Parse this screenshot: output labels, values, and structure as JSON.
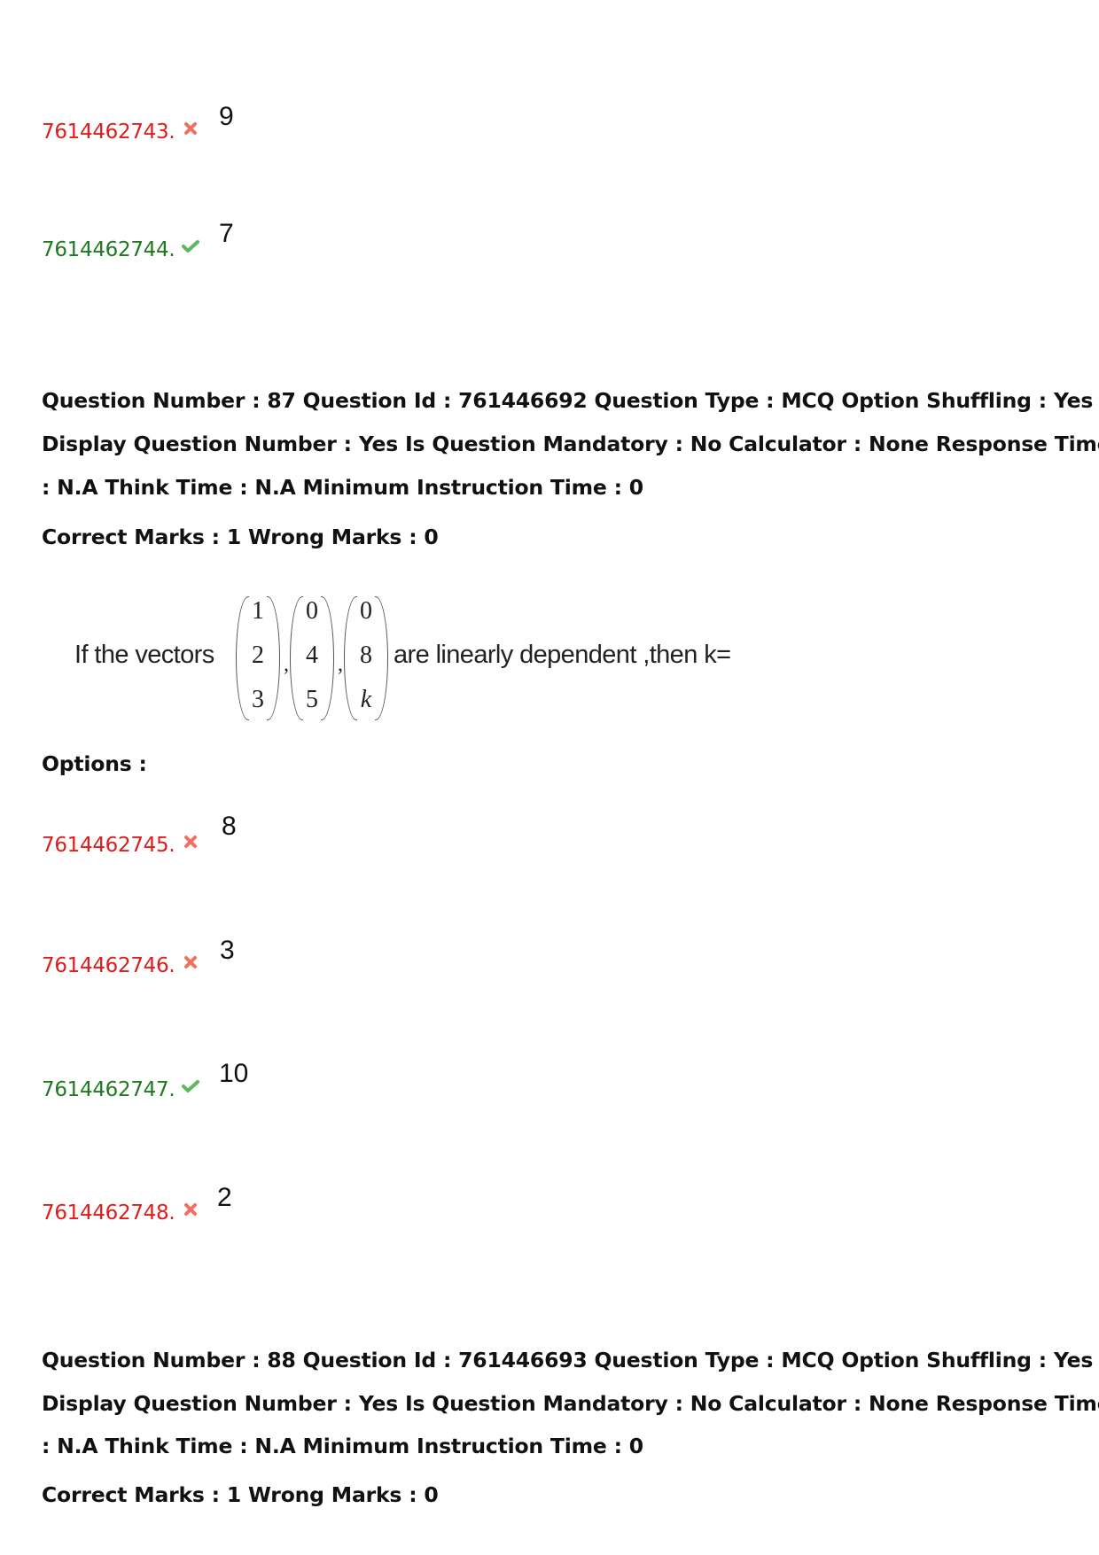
{
  "colors": {
    "wrong": "#e01b1b",
    "correct": "#1f7a1f",
    "wrong_icon": "#f07060",
    "correct_icon": "#5cb85c"
  },
  "prev_options": [
    {
      "id": "7614462743.",
      "status": "wrong",
      "icon": "cross-icon",
      "answer": "9"
    },
    {
      "id": "7614462744.",
      "status": "correct",
      "icon": "check-icon",
      "answer": "7"
    }
  ],
  "q87": {
    "header_lines": [
      "Question Number : 87 Question Id : 761446692 Question Type : MCQ Option Shuffling : Yes",
      "Display Question Number : Yes Is Question Mandatory : No Calculator : None Response Time",
      ": N.A Think Time : N.A Minimum Instruction Time : 0"
    ],
    "marks": "Correct Marks : 1 Wrong Marks : 0",
    "question": {
      "prefix": "If the vectors",
      "vectors": [
        [
          "1",
          "2",
          "3"
        ],
        [
          "0",
          "4",
          "5"
        ],
        [
          "0",
          "8",
          "k"
        ]
      ],
      "comma": ",",
      "suffix": "are linearly dependent ,then k="
    },
    "options_label": "Options :",
    "options": [
      {
        "id": "7614462745.",
        "status": "wrong",
        "icon": "cross-icon",
        "answer": "8"
      },
      {
        "id": "7614462746.",
        "status": "wrong",
        "icon": "cross-icon",
        "answer": "3"
      },
      {
        "id": "7614462747.",
        "status": "correct",
        "icon": "check-icon",
        "answer": "10"
      },
      {
        "id": "7614462748.",
        "status": "wrong",
        "icon": "cross-icon",
        "answer": "2"
      }
    ]
  },
  "q88": {
    "header_lines": [
      "Question Number : 88 Question Id : 761446693 Question Type : MCQ Option Shuffling : Yes",
      "Display Question Number : Yes Is Question Mandatory : No Calculator : None Response Time",
      ": N.A Think Time : N.A Minimum Instruction Time : 0"
    ],
    "marks": "Correct Marks : 1 Wrong Marks : 0"
  }
}
